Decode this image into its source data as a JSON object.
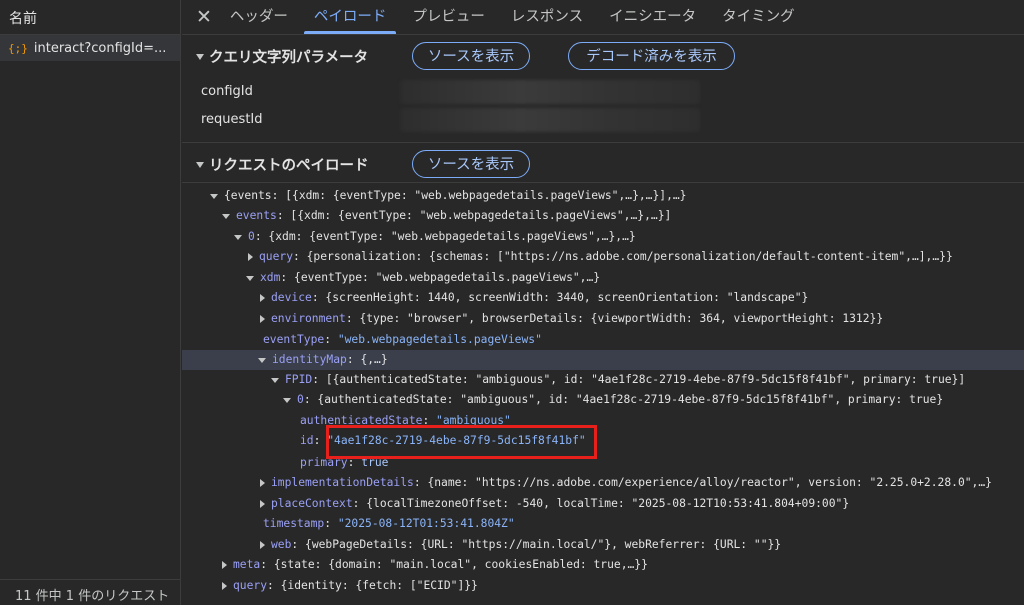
{
  "left_panel": {
    "header": "名前",
    "request_icon": "{;}",
    "request_name": "interact?configId=...",
    "footer": "11 件中 1 件のリクエスト"
  },
  "tabs": {
    "close": "✕",
    "items": [
      "ヘッダー",
      "ペイロード",
      "プレビュー",
      "レスポンス",
      "イニシエータ",
      "タイミング"
    ],
    "active": "ペイロード"
  },
  "query_section": {
    "title": "クエリ文字列パラメータ",
    "view_source": "ソースを表示",
    "view_decoded": "デコード済みを表示",
    "params": [
      "configId",
      "requestId"
    ]
  },
  "payload_section": {
    "title": "リクエストのペイロード",
    "view_source": "ソースを表示"
  },
  "tree": [
    {
      "k": "",
      "v": "{events: [{xdm: {eventType: \"web.webpagedetails.pageViews\",…},…}],…}"
    },
    {
      "k": "events",
      "v": "[{xdm: {eventType: \"web.webpagedetails.pageViews\",…},…}]"
    },
    {
      "k": "0",
      "v": "{xdm: {eventType: \"web.webpagedetails.pageViews\",…},…}"
    },
    {
      "k": "query",
      "v": "{personalization: {schemas: [\"https://ns.adobe.com/personalization/default-content-item\",…],…}}"
    },
    {
      "k": "xdm",
      "v": "{eventType: \"web.webpagedetails.pageViews\",…}"
    },
    {
      "k": "device",
      "v": "{screenHeight: 1440, screenWidth: 3440, screenOrientation: \"landscape\"}"
    },
    {
      "k": "environment",
      "v": "{type: \"browser\", browserDetails: {viewportWidth: 364, viewportHeight: 1312}}"
    },
    {
      "k": "eventType",
      "v": "\"web.webpagedetails.pageViews\""
    },
    {
      "k": "identityMap",
      "v": "{,…}"
    },
    {
      "k": "FPID",
      "v": "[{authenticatedState: \"ambiguous\", id: \"4ae1f28c-2719-4ebe-87f9-5dc15f8f41bf\", primary: true}]"
    },
    {
      "k": "0",
      "v": "{authenticatedState: \"ambiguous\", id: \"4ae1f28c-2719-4ebe-87f9-5dc15f8f41bf\", primary: true}"
    },
    {
      "k": "authenticatedState",
      "v": "\"ambiguous\""
    },
    {
      "k": "id",
      "v": "\"4ae1f28c-2719-4ebe-87f9-5dc15f8f41bf\""
    },
    {
      "k": "primary",
      "v": "true"
    },
    {
      "k": "implementationDetails",
      "v": "{name: \"https://ns.adobe.com/experience/alloy/reactor\", version: \"2.25.0+2.28.0\",…}"
    },
    {
      "k": "placeContext",
      "v": "{localTimezoneOffset: -540, localTime: \"2025-08-12T10:53:41.804+09:00\"}"
    },
    {
      "k": "timestamp",
      "v": "\"2025-08-12T01:53:41.804Z\""
    },
    {
      "k": "web",
      "v": "{webPageDetails: {URL: \"https://main.local/\"}, webReferrer: {URL: \"\"}}"
    },
    {
      "k": "meta",
      "v": "{state: {domain: \"main.local\", cookiesEnabled: true,…}}"
    },
    {
      "k": "query",
      "v": "{identity: {fetch: [\"ECID\"]}}"
    }
  ],
  "colors": {
    "accent": "#7cacf8",
    "highlight_box": "#e8201c"
  }
}
